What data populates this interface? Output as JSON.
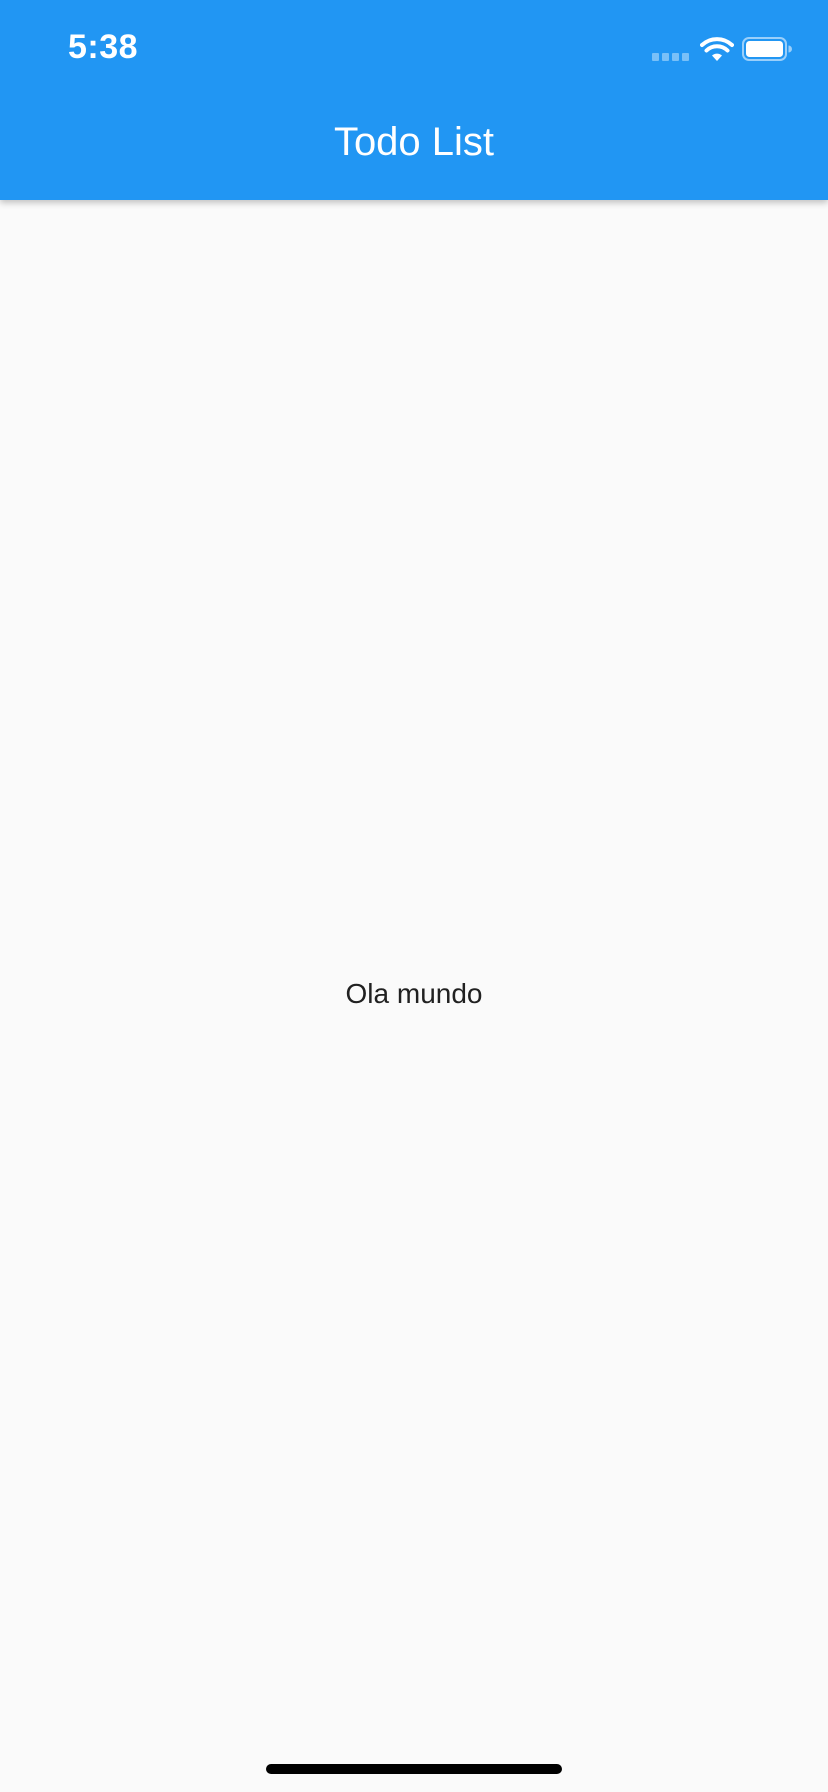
{
  "status_bar": {
    "time": "5:38",
    "icons": [
      "cellular-signal-icon",
      "wifi-icon",
      "battery-icon"
    ]
  },
  "app_bar": {
    "title": "Todo List",
    "color": "#2196f3"
  },
  "main": {
    "text": "Ola mundo"
  },
  "colors": {
    "background": "#fafafa",
    "text": "#212121",
    "app_bar_text": "#ffffff"
  }
}
